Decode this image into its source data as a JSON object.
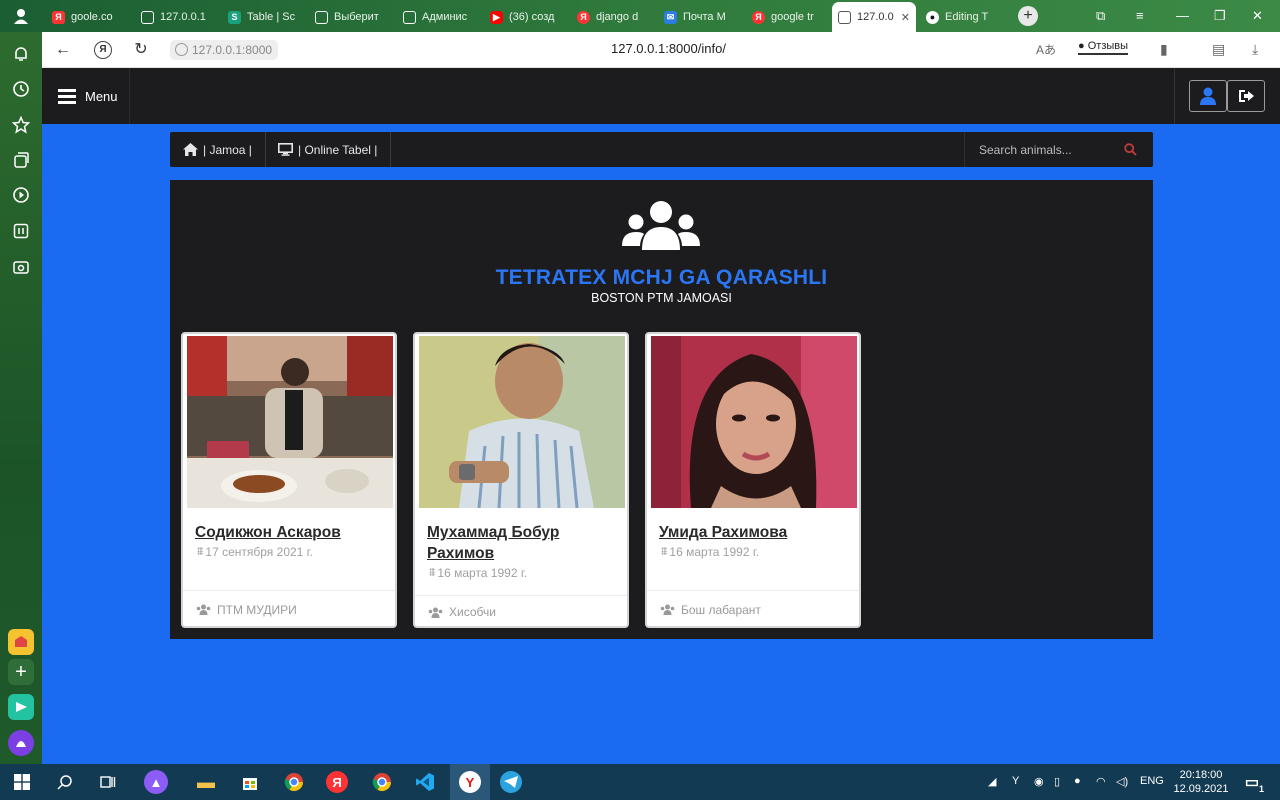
{
  "browser": {
    "tabs": [
      {
        "label": "goole.co",
        "icon": "yandex-icon",
        "color": "#ff3333"
      },
      {
        "label": "127.0.0.1",
        "icon": "page-icon",
        "color": "#ffffff"
      },
      {
        "label": "Table | Sc",
        "icon": "sheets-icon",
        "color": "#1aa27f"
      },
      {
        "label": "Выберит",
        "icon": "page-icon",
        "color": "#ffffff"
      },
      {
        "label": "Админис",
        "icon": "page-icon",
        "color": "#ffffff"
      },
      {
        "label": "(36) созд",
        "icon": "youtube-icon",
        "color": "#ff0000"
      },
      {
        "label": "django d",
        "icon": "yandex-icon",
        "color": "#ff3333"
      },
      {
        "label": "Почта M",
        "icon": "mail-icon",
        "color": "#2c7de0"
      },
      {
        "label": "google tr",
        "icon": "yandex-icon",
        "color": "#ff3333"
      },
      {
        "label": "127.0.0",
        "icon": "page-icon",
        "color": "#ffffff"
      },
      {
        "label": "Editing T",
        "icon": "github-icon",
        "color": "#ffffff"
      }
    ],
    "url_host": "127.0.0.1:8000",
    "url_full": "127.0.0.1:8000/info/",
    "feedback_label": "Отзывы"
  },
  "nav": {
    "menu_label": "Menu",
    "items": [
      {
        "label": "| Jamoa |",
        "icon": "home-icon"
      },
      {
        "label": "| Online Tabel |",
        "icon": "desktop-icon"
      }
    ],
    "search_placeholder": "Search animals..."
  },
  "panel": {
    "title": "TETRATEX MCHJ GA QARASHLI",
    "subtitle": "BOSTON PTM JAMOASI"
  },
  "cards": [
    {
      "name": "Содикжон Аскаров",
      "date": "17 сентября 2021 г.",
      "role": "ПТМ МУДИРИ"
    },
    {
      "name": "Мухаммад Бобур Рахимов",
      "date": "16 марта 1992 г.",
      "role": "Хисобчи"
    },
    {
      "name": "Умида Рахимова",
      "date": "16 марта 1992 г.",
      "role": "Бош лабарант"
    }
  ],
  "taskbar": {
    "lang": "ENG",
    "time": "20:18:00",
    "date": "12.09.2021",
    "notifications": "1"
  },
  "colors": {
    "page_bg": "#1b6bf2",
    "dark": "#1c1c1e",
    "title_blue": "#2b76f5"
  }
}
